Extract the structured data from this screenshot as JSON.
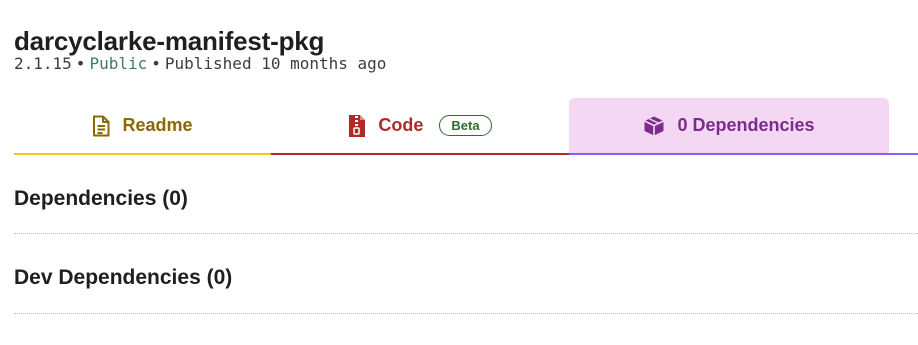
{
  "package": {
    "name": "darcyclarke-manifest-pkg",
    "version": "2.1.15",
    "separator": "•",
    "visibility": "Public",
    "published": "Published 10 months ago"
  },
  "tabs": {
    "readme": {
      "label": "Readme",
      "icon": "readme-file-icon",
      "color": "#8a6a00",
      "underline": "#f5c518"
    },
    "code": {
      "label": "Code",
      "icon": "zip-file-icon",
      "badge": "Beta",
      "color": "#b02a2a"
    },
    "dependencies": {
      "label": "0 Dependencies",
      "icon": "package-box-icon",
      "color": "#7a2d8c",
      "background": "#f4d7f2",
      "active": true
    }
  },
  "sections": {
    "dependencies": {
      "heading": "Dependencies (0)"
    },
    "dev_dependencies": {
      "heading": "Dev Dependencies (0)"
    }
  }
}
